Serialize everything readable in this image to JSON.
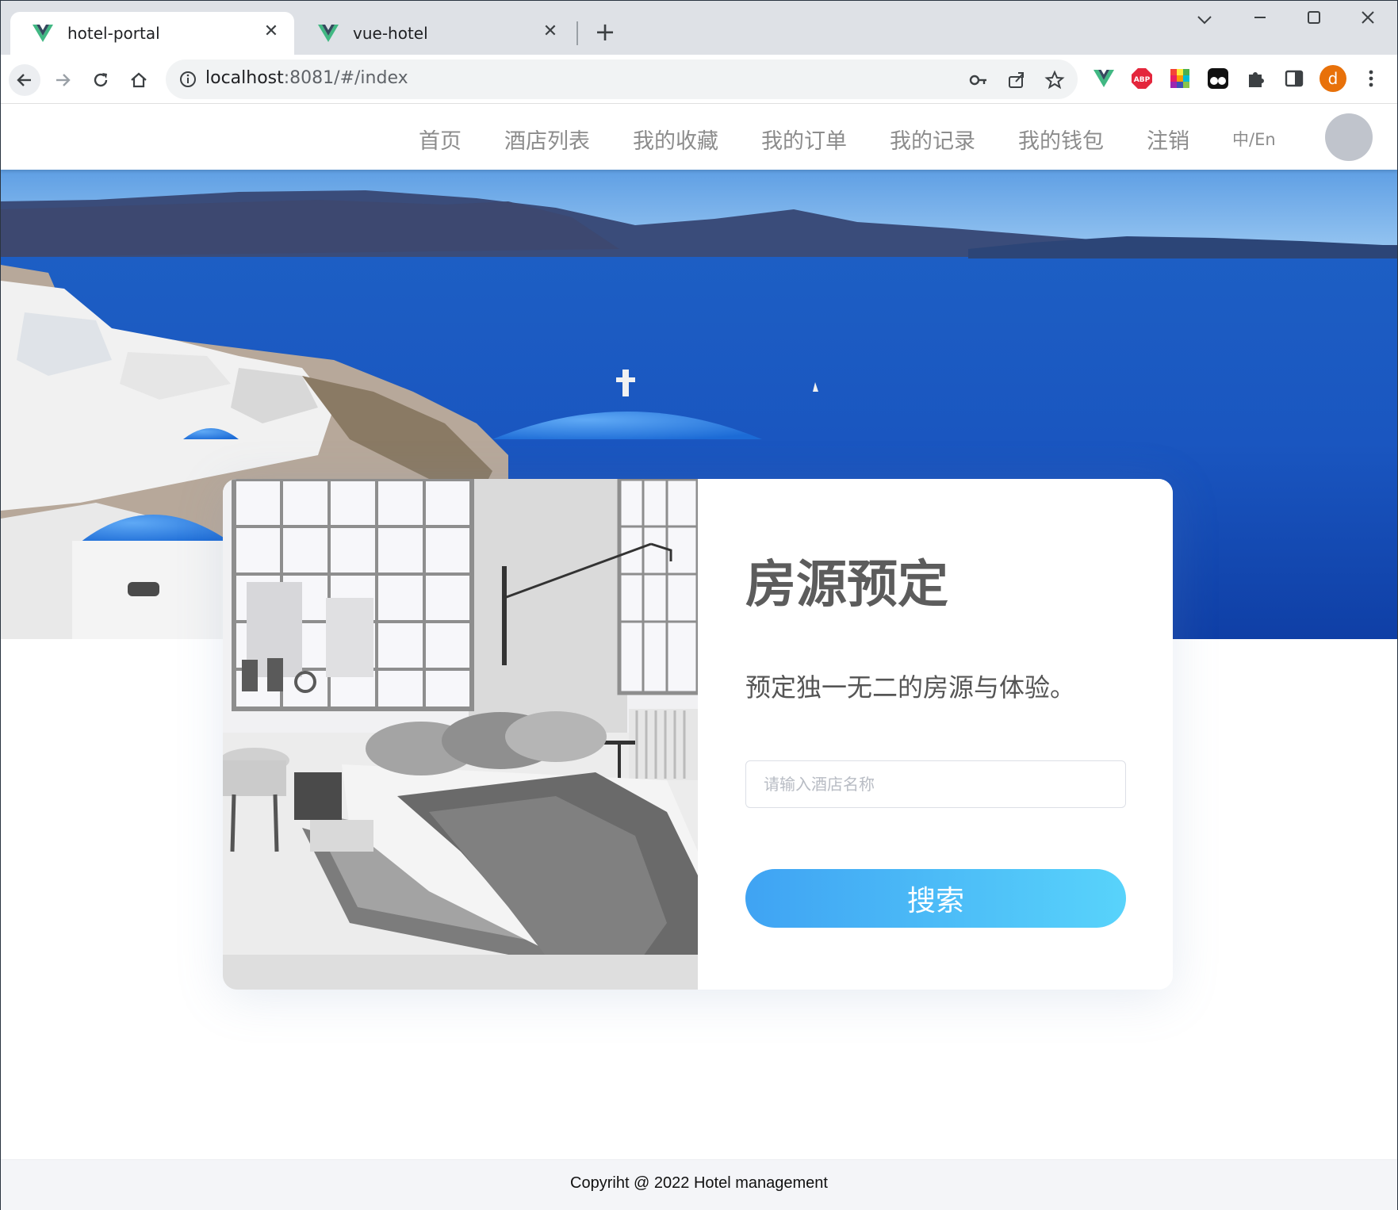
{
  "browser": {
    "tabs": [
      {
        "title": "hotel-portal",
        "active": true
      },
      {
        "title": "vue-hotel",
        "active": false
      }
    ],
    "url_host": "localhost",
    "url_rest": ":8081/#/index",
    "profile_initial": "d",
    "colors": {
      "vue_green": "#41b883",
      "vue_dark": "#35495e",
      "profile": "#e8710a"
    }
  },
  "nav": {
    "items": [
      "首页",
      "酒店列表",
      "我的收藏",
      "我的订单",
      "我的记录",
      "我的钱包",
      "注销"
    ],
    "lang": "中/En"
  },
  "booking": {
    "title": "房源预定",
    "subtitle": "预定独一无二的房源与体验。",
    "search_placeholder": "请输入酒店名称",
    "search_button": "搜索"
  },
  "footer": {
    "copyright": "Copyriht @ 2022 Hotel management"
  }
}
